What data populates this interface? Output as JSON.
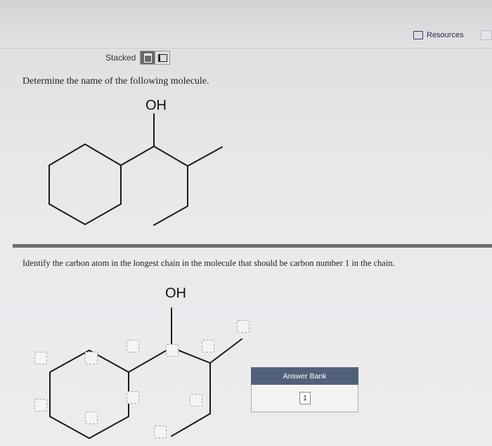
{
  "toolbar": {
    "resources_label": "Resources"
  },
  "view": {
    "stacked_label": "Stacked",
    "selected": "stacked"
  },
  "question1": {
    "text": "Determine the name of the following molecule.",
    "hydroxyl_label": "OH"
  },
  "question2": {
    "text": "Identify the carbon atom in the longest chain in the molecule that should be carbon number 1 in the chain.",
    "hydroxyl_label": "OH"
  },
  "answer_bank": {
    "title": "Answer Bank",
    "items": [
      "1"
    ]
  },
  "colors": {
    "bank_header": "#52617a",
    "divider": "#6c6c6c"
  }
}
